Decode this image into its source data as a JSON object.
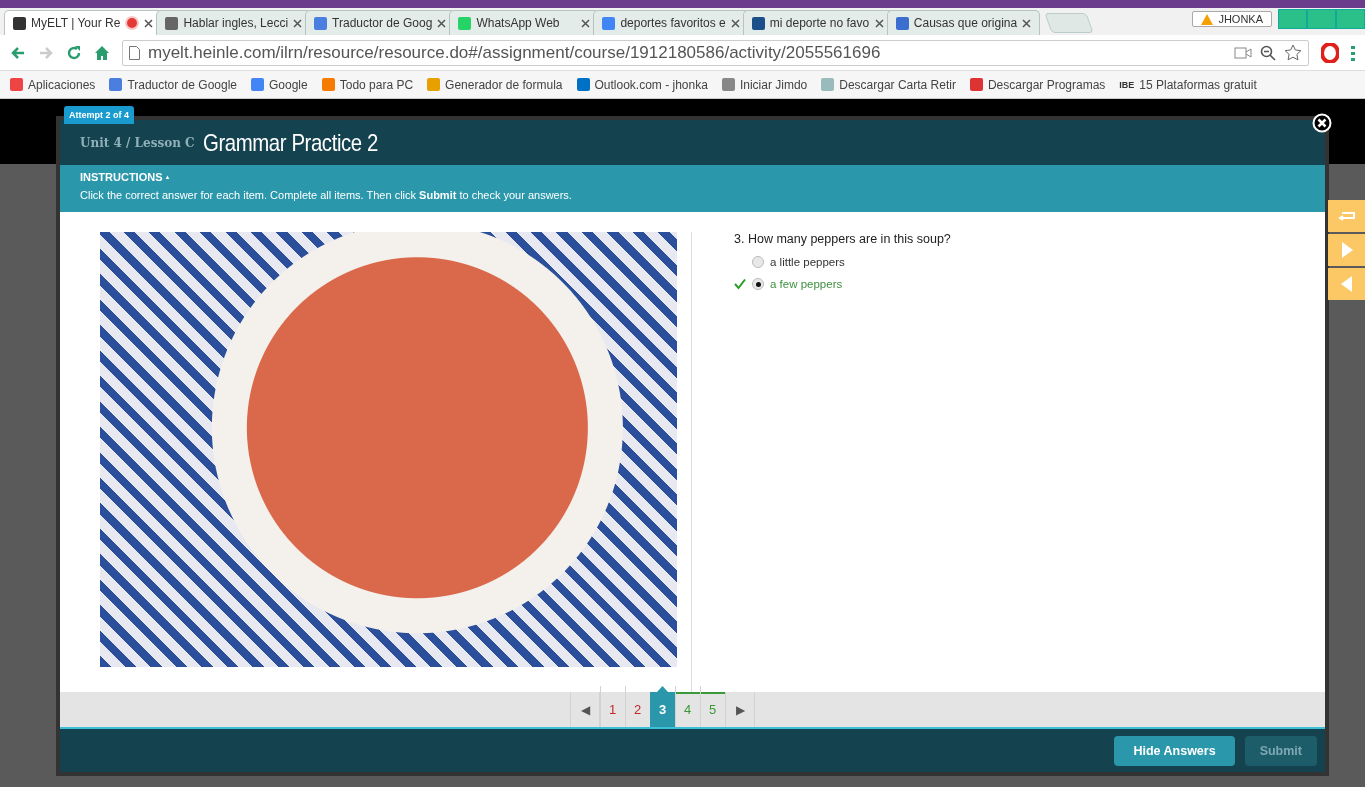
{
  "browser": {
    "tabs": [
      {
        "title": "MyELT | Your Re",
        "selected": true,
        "recording": true
      },
      {
        "title": "Hablar ingles, Lecci",
        "selected": false,
        "recording": false
      },
      {
        "title": "Traductor de Goog",
        "selected": false,
        "recording": false
      },
      {
        "title": "WhatsApp Web",
        "selected": false,
        "recording": false
      },
      {
        "title": "deportes favoritos e",
        "selected": false,
        "recording": false
      },
      {
        "title": "mi deporte no favo",
        "selected": false,
        "recording": false
      },
      {
        "title": "Causas que origina",
        "selected": false,
        "recording": false
      }
    ],
    "profile": "JHONKA",
    "url": "myelt.heinle.com/ilrn/resource/resource.do#/assignment/course/1912180586/activity/2055561696",
    "bookmarks": [
      "Aplicaciones",
      "Traductor de Google",
      "Google",
      "Todo para PC",
      "Generador de formula",
      "Outlook.com - jhonka",
      "Iniciar Jimdo",
      "Descargar Carta Retir",
      "Descargar Programas",
      "15 Plataformas gratuit"
    ],
    "bookmark_prefix": "IBE"
  },
  "modal": {
    "attempt": "Attempt 2 of 4",
    "breadcrumb": "Unit 4 / Lesson C",
    "title": "Grammar Practice 2",
    "instructions": {
      "heading": "INSTRUCTIONS",
      "toggle": "▲",
      "text": "Click the correct answer for each item. Complete all items. Then click **Submit** to check your answers."
    },
    "question": {
      "text": "3. How many peppers are in this soup?",
      "options": [
        {
          "label": "a little peppers",
          "selected": false,
          "correct": false
        },
        {
          "label": "a few peppers",
          "selected": true,
          "correct": true
        }
      ]
    },
    "pager": {
      "prev": "◀",
      "next": "▶",
      "pages": [
        {
          "label": "1",
          "selected": false,
          "correct": false
        },
        {
          "label": "2",
          "selected": false,
          "correct": false
        },
        {
          "label": "3",
          "selected": true,
          "correct": true
        },
        {
          "label": "4",
          "selected": false,
          "correct": true
        },
        {
          "label": "5",
          "selected": false,
          "correct": true
        }
      ]
    },
    "buttons": [
      {
        "label": "Hide Answers",
        "disabled": false
      },
      {
        "label": "Submit",
        "disabled": true
      }
    ]
  }
}
